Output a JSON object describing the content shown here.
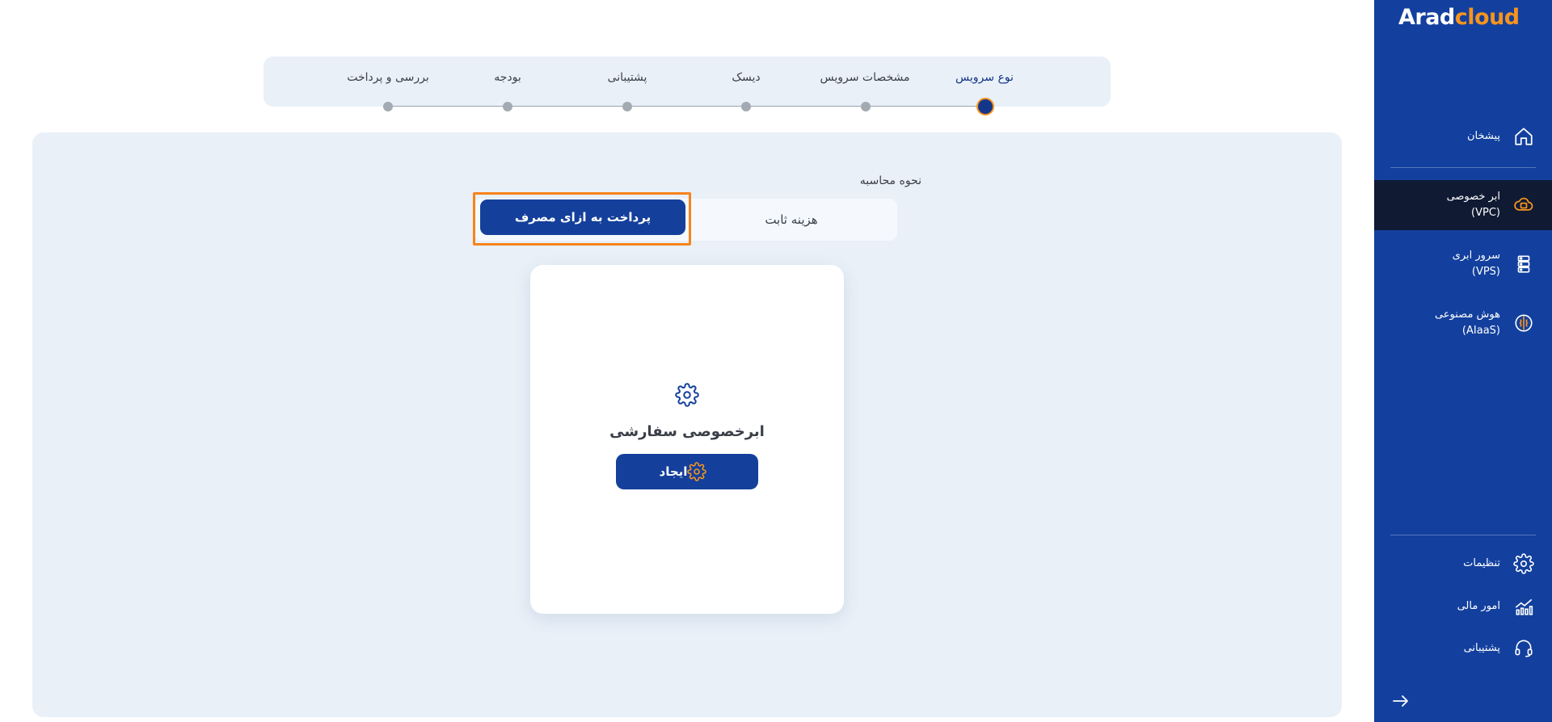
{
  "brand": {
    "name_part1": "Arad",
    "name_part2": "cloud",
    "colors": {
      "primary": "#13409e",
      "accent": "#f7941d",
      "active_nav": "#101a33",
      "panel": "#e9f0f8"
    }
  },
  "sidebar": {
    "items": [
      {
        "id": "dashboard",
        "line1": "پیشخان",
        "line2": "",
        "icon": "home-icon"
      },
      {
        "id": "vpc",
        "line1": "ابر خصوصی",
        "line2": "(VPC)",
        "icon": "cloud-icon",
        "active": true
      },
      {
        "id": "vps",
        "line1": "سرور ابری",
        "line2": "(VPS)",
        "icon": "server-icon"
      },
      {
        "id": "aiaas",
        "line1": "هوش مصنوعی",
        "line2": "(AIaaS)",
        "icon": "brain-icon"
      }
    ],
    "bottom_items": [
      {
        "id": "settings",
        "label": "تنظیمات",
        "icon": "gear-icon"
      },
      {
        "id": "finance",
        "label": "امور مالی",
        "icon": "chart-icon"
      },
      {
        "id": "support",
        "label": "پشتیبانی",
        "icon": "headset-icon"
      }
    ],
    "collapse_icon": "arrow-right-icon"
  },
  "stepper": {
    "steps": [
      {
        "label": "نوع سرویس",
        "current": true
      },
      {
        "label": "مشخصات سرویس"
      },
      {
        "label": "دیسک"
      },
      {
        "label": "پشتیبانی"
      },
      {
        "label": "بودجه"
      },
      {
        "label": "بررسی و پرداخت"
      }
    ]
  },
  "billing": {
    "label": "نحوه محاسبه",
    "options": {
      "fixed": "هزینه ثابت",
      "payg": "پرداخت به ازای مصرف"
    },
    "selected": "payg"
  },
  "card": {
    "icon": "gear-icon",
    "title": "ابرخصوصی سفارشی",
    "button_label": "ایجاد",
    "button_icon": "gear-icon"
  }
}
